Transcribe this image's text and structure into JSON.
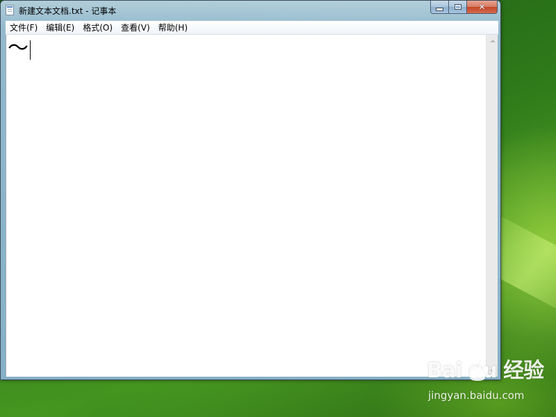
{
  "window": {
    "title": "新建文本文档.txt - 记事本"
  },
  "menu": {
    "items": [
      {
        "label": "文件(F)"
      },
      {
        "label": "编辑(E)"
      },
      {
        "label": "格式(O)"
      },
      {
        "label": "查看(V)"
      },
      {
        "label": "帮助(H)"
      }
    ]
  },
  "editor": {
    "content": "～"
  },
  "watermark": {
    "logo_text": "Bai du 经验",
    "url": "jingyan.baidu.com"
  },
  "icons": {
    "app": "notepad-icon",
    "minimize": "minimize-icon",
    "maximize": "maximize-icon",
    "close": "close-icon",
    "scroll_up": "scroll-up-arrow-icon",
    "scroll_down": "scroll-down-arrow-icon",
    "watermark": "baidu-paw-icon"
  },
  "colors": {
    "desktop": "#2f7a1a",
    "close_button": "#c2462a",
    "window_frame": "#a9c3dc"
  }
}
